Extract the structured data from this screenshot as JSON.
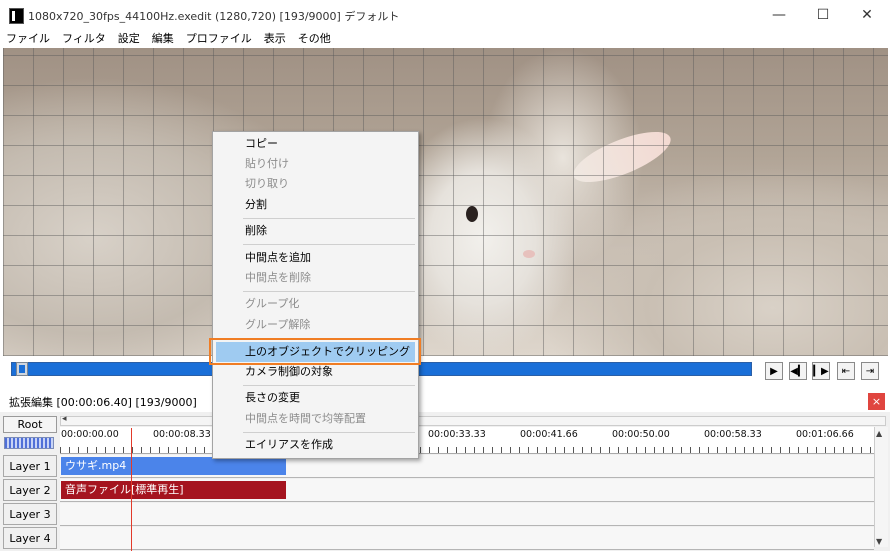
{
  "window": {
    "title": "1080x720_30fps_44100Hz.exedit (1280,720)  [193/9000]  デフォルト",
    "minimize": "—",
    "maximize": "☐",
    "close": "✕"
  },
  "menu": [
    "ファイル",
    "フィルタ",
    "設定",
    "編集",
    "プロファイル",
    "表示",
    "その他"
  ],
  "transport": {
    "play": "▶",
    "prev_frame": "◀▎",
    "next_frame": "▎▶",
    "to_start": "⇤",
    "to_end": "⇥"
  },
  "extended_edit": {
    "title": "拡張編集 [00:00:06.40] [193/9000]",
    "close": "×",
    "root_label": "Root",
    "ruler_ticks": [
      "00:00:00.00",
      "00:00:08.33",
      "00:00:33.33",
      "00:00:41.66",
      "00:00:50.00",
      "00:00:58.33",
      "00:01:06.66"
    ],
    "layers": [
      "Layer 1",
      "Layer 2",
      "Layer 3",
      "Layer 4"
    ],
    "clips": {
      "video": "ウサギ.mp4",
      "audio": "音声ファイル[標準再生]"
    },
    "colors": {
      "video_clip": "#4b84ea",
      "audio_clip": "#a5141f",
      "playhead": "#e23a2a"
    }
  },
  "context_menu": {
    "items": [
      {
        "label": "コピー",
        "enabled": true
      },
      {
        "label": "貼り付け",
        "enabled": false
      },
      {
        "label": "切り取り",
        "enabled": false
      },
      {
        "label": "分割",
        "enabled": true
      },
      {
        "label": "削除",
        "enabled": true
      },
      {
        "label": "中間点を追加",
        "enabled": true
      },
      {
        "label": "中間点を削除",
        "enabled": false
      },
      {
        "label": "グループ化",
        "enabled": false
      },
      {
        "label": "グループ解除",
        "enabled": false
      },
      {
        "label": "上のオブジェクトでクリッピング",
        "enabled": true,
        "highlighted": true
      },
      {
        "label": "カメラ制御の対象",
        "enabled": true
      },
      {
        "label": "長さの変更",
        "enabled": true
      },
      {
        "label": "中間点を時間で均等配置",
        "enabled": false
      },
      {
        "label": "エイリアスを作成",
        "enabled": true
      }
    ],
    "highlight_color": "#9fcbf1",
    "callout_color": "#f07d24"
  }
}
